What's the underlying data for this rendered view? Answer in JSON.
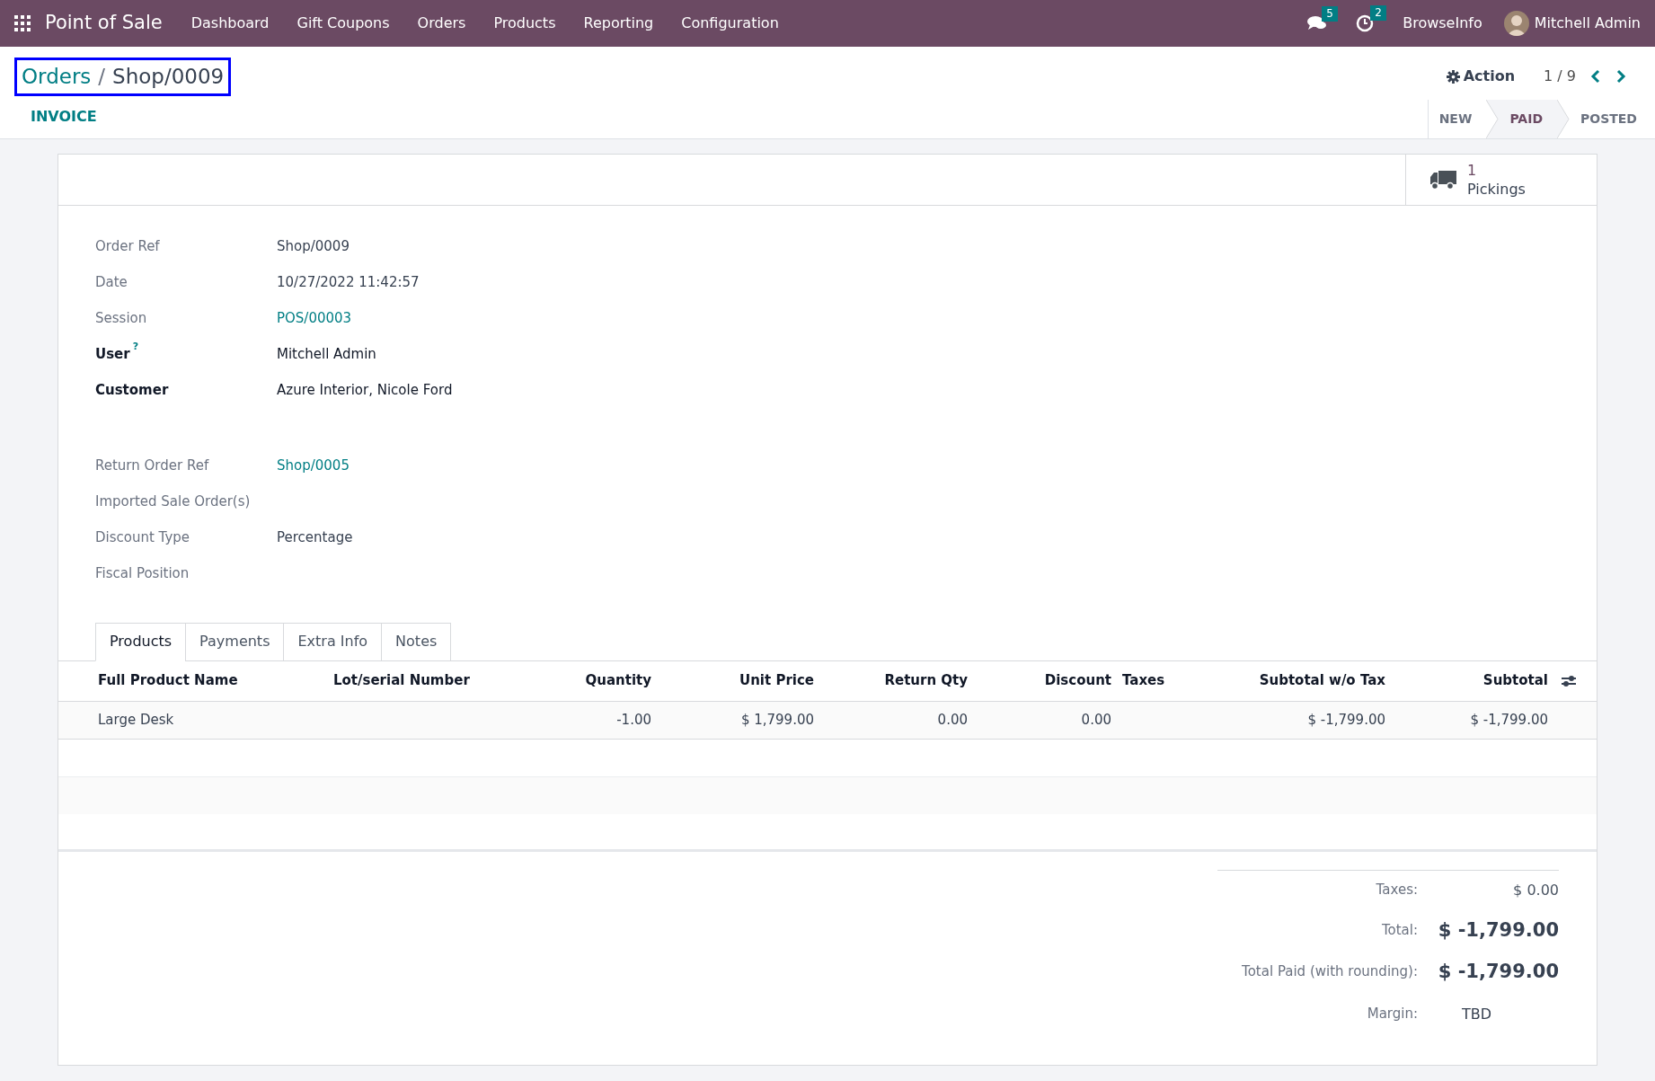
{
  "navbar": {
    "app_name": "Point of Sale",
    "menu": [
      "Dashboard",
      "Gift Coupons",
      "Orders",
      "Products",
      "Reporting",
      "Configuration"
    ],
    "messages_count": "5",
    "activities_count": "2",
    "company": "BrowseInfo",
    "user": "Mitchell Admin"
  },
  "breadcrumb": {
    "parent": "Orders",
    "separator": "/",
    "current": "Shop/0009",
    "highlighted": true
  },
  "action": "Action",
  "pager": "1 / 9",
  "header_buttons": [
    "INVOICE"
  ],
  "status_steps": [
    {
      "label": "NEW",
      "selected": false
    },
    {
      "label": "PAID",
      "selected": true
    },
    {
      "label": "POSTED",
      "selected": false
    }
  ],
  "smart_button": {
    "count": "1",
    "label": "Pickings"
  },
  "field_groups": [
    [
      {
        "label": "Order Ref",
        "value": "Shop/0009",
        "required": false,
        "link": false
      },
      {
        "label": "Date",
        "value": "10/27/2022 11:42:57",
        "required": false,
        "link": false
      },
      {
        "label": "Session",
        "value": "POS/00003",
        "required": false,
        "link": true
      },
      {
        "label": "User",
        "help": "?",
        "value": "Mitchell Admin",
        "required": true,
        "link": false
      },
      {
        "label": "Customer",
        "value": "Azure Interior, Nicole Ford",
        "required": true,
        "link": false
      }
    ],
    [
      {
        "label": "Return Order Ref",
        "value": "Shop/0005",
        "required": false,
        "link": true
      },
      {
        "label": "Imported Sale Order(s)",
        "required": false
      },
      {
        "label": "Discount Type",
        "value": "Percentage",
        "required": false,
        "link": false
      },
      {
        "label": "Fiscal Position",
        "required": false
      }
    ]
  ],
  "tabs": [
    {
      "label": "Products",
      "selected": true
    },
    {
      "label": "Payments",
      "selected": false
    },
    {
      "label": "Extra Info",
      "selected": false
    },
    {
      "label": "Notes",
      "selected": false
    }
  ],
  "table": {
    "columns": [
      "Full Product Name",
      "Lot/serial Number",
      "Quantity",
      "Unit Price",
      "Return Qty",
      "Discount",
      "Taxes",
      "Subtotal w/o Tax",
      "Subtotal"
    ],
    "rows": [
      [
        "Large Desk",
        "",
        "-1.00",
        "$ 1,799.00",
        "0.00",
        "0.00",
        "",
        "$ -1,799.00",
        "$ -1,799.00"
      ]
    ]
  },
  "totals": [
    {
      "label": "Taxes:",
      "value": "$ 0.00",
      "kind": "small"
    },
    {
      "label": "Total:",
      "value": "$ -1,799.00",
      "kind": "big"
    },
    {
      "label": "Total Paid (with rounding):",
      "value": "$ -1,799.00",
      "kind": "big"
    },
    {
      "label": "Margin:",
      "value": "TBD",
      "kind": "plain"
    }
  ]
}
